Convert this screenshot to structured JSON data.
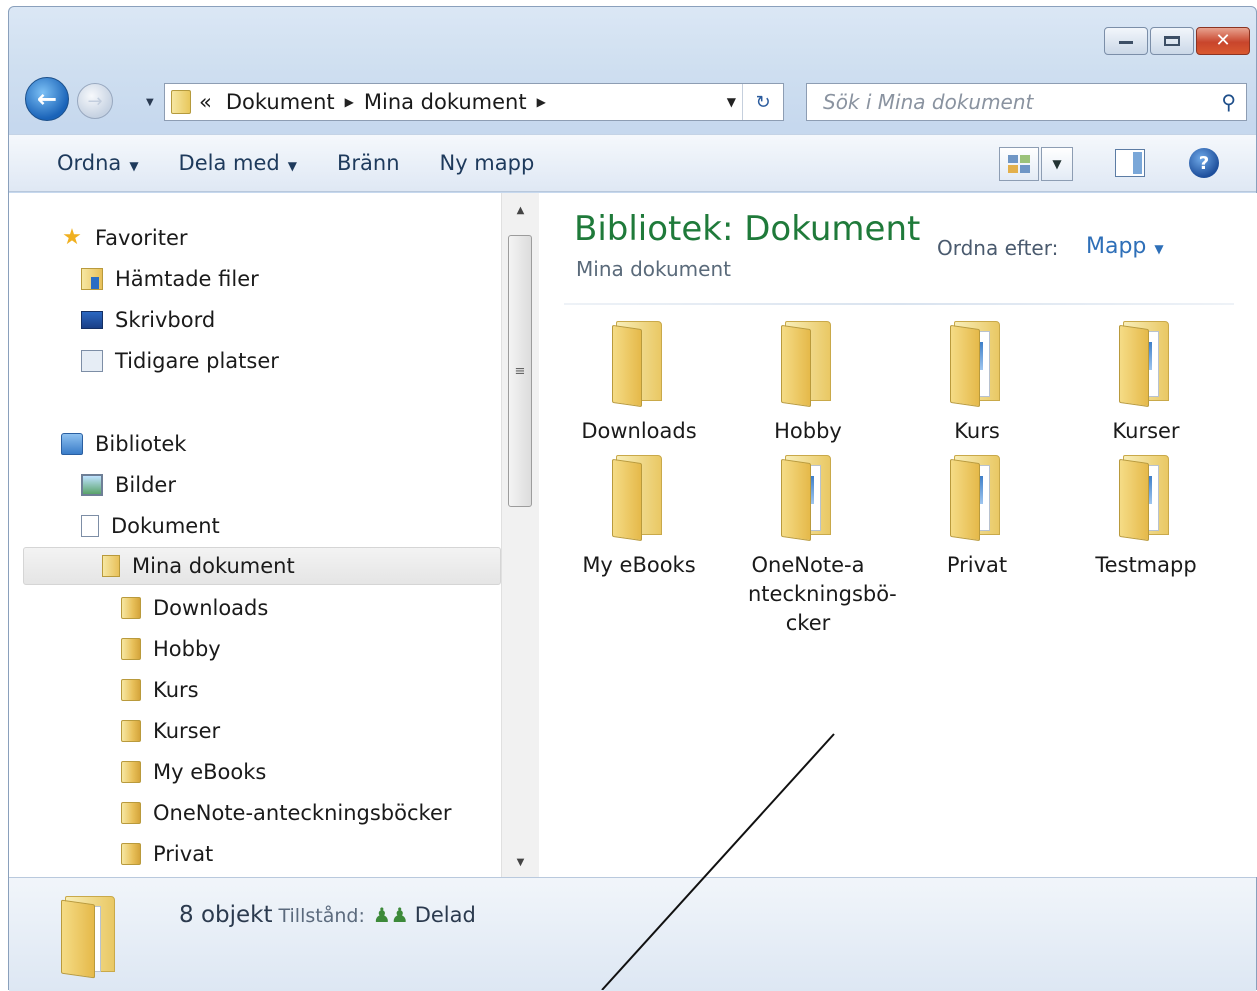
{
  "address": {
    "overflow": "«",
    "crumbs": [
      "Dokument",
      "Mina dokument"
    ]
  },
  "search": {
    "placeholder": "Sök i Mina dokument"
  },
  "toolbar": {
    "organize": "Ordna",
    "share": "Dela med",
    "burn": "Bränn",
    "new_folder": "Ny mapp"
  },
  "nav": {
    "favorites_header": "Favoriter",
    "favorites": [
      "Hämtade filer",
      "Skrivbord",
      "Tidigare platser"
    ],
    "libraries_header": "Bibliotek",
    "libraries": [
      "Bilder",
      "Dokument"
    ],
    "selected": "Mina dokument",
    "subfolders": [
      "Downloads",
      "Hobby",
      "Kurs",
      "Kurser",
      "My eBooks",
      "OneNote-anteckningsböcker",
      "Privat"
    ]
  },
  "content": {
    "title": "Bibliotek: Dokument",
    "subtitle": "Mina dokument",
    "arrange_label": "Ordna efter:",
    "arrange_value": "Mapp",
    "items": [
      {
        "name": "Downloads",
        "docs": false
      },
      {
        "name": "Hobby",
        "docs": false
      },
      {
        "name": "Kurs",
        "docs": true
      },
      {
        "name": "Kurser",
        "docs": true
      },
      {
        "name": "My eBooks",
        "docs": false
      },
      {
        "name": "OneNote-a\nnteckningsböcker",
        "docs": true
      },
      {
        "name": "Privat",
        "docs": true
      },
      {
        "name": "Testmapp",
        "docs": true
      }
    ]
  },
  "status": {
    "count": "8 objekt",
    "state_label": "Tillstånd:",
    "state_value": "Delad"
  }
}
